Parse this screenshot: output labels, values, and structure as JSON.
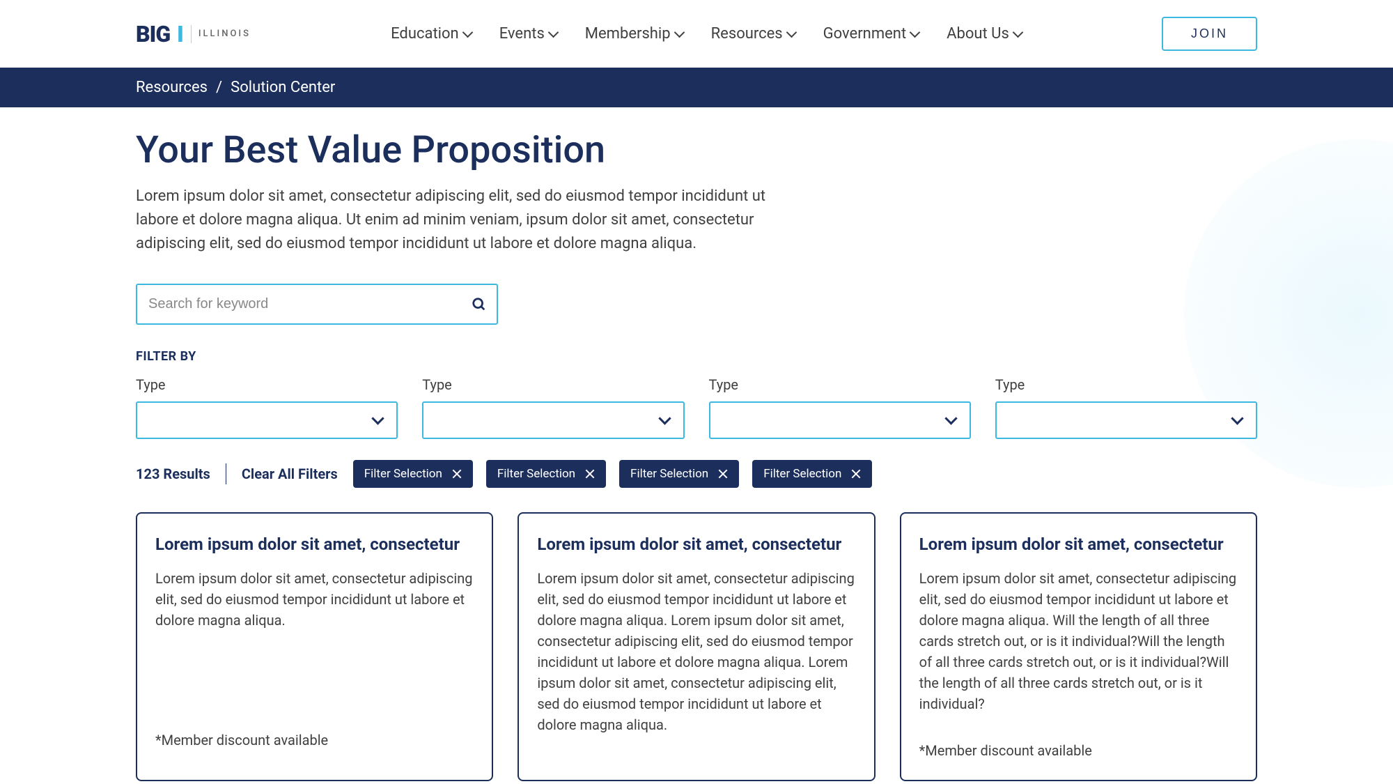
{
  "header": {
    "logo": {
      "big": "BIG",
      "i": "I",
      "illinois": "ILLINOIS"
    },
    "nav": [
      "Education",
      "Events",
      "Membership",
      "Resources",
      "Government",
      "About Us"
    ],
    "join": "JOIN"
  },
  "breadcrumb": {
    "parent": "Resources",
    "current": "Solution Center"
  },
  "page": {
    "title": "Your Best Value Proposition",
    "desc": "Lorem ipsum dolor sit amet, consectetur adipiscing elit, sed do eiusmod tempor incididunt ut labore et dolore magna aliqua. Ut enim ad minim veniam, ipsum dolor sit amet, consectetur adipiscing elit, sed do eiusmod tempor incididunt ut labore et dolore magna aliqua."
  },
  "search": {
    "placeholder": "Search for keyword"
  },
  "filter": {
    "label": "FILTER BY",
    "cols": [
      {
        "label": "Type"
      },
      {
        "label": "Type"
      },
      {
        "label": "Type"
      },
      {
        "label": "Type"
      }
    ]
  },
  "results": {
    "count": "123 Results",
    "clear": "Clear All Filters",
    "chips": [
      "Filter Selection",
      "Filter Selection",
      "Filter Selection",
      "Filter Selection"
    ]
  },
  "cards": [
    {
      "title": "Lorem ipsum dolor sit amet, consectetur",
      "body": "Lorem ipsum dolor sit amet, consectetur adipiscing elit, sed do eiusmod tempor incididunt ut labore et dolore magna aliqua.",
      "footer": "*Member discount available"
    },
    {
      "title": "Lorem ipsum dolor sit amet, consectetur",
      "body": "Lorem ipsum dolor sit amet, consectetur adipiscing elit, sed do eiusmod tempor incididunt ut labore et dolore magna aliqua. Lorem ipsum dolor sit amet, consectetur adipiscing elit, sed do eiusmod tempor incididunt ut labore et dolore magna aliqua. Lorem ipsum dolor sit amet, consectetur adipiscing elit, sed do eiusmod tempor incididunt ut labore et dolore magna aliqua.",
      "footer": ""
    },
    {
      "title": "Lorem ipsum dolor sit amet, consectetur",
      "body": "Lorem ipsum dolor sit amet, consectetur adipiscing elit, sed do eiusmod tempor incididunt ut labore et dolore magna aliqua. Will the length of all three cards stretch out, or is it individual?Will the length of all three cards stretch out, or is it individual?Will the length of all three cards stretch out, or is it individual?",
      "footer": "*Member discount available"
    }
  ]
}
